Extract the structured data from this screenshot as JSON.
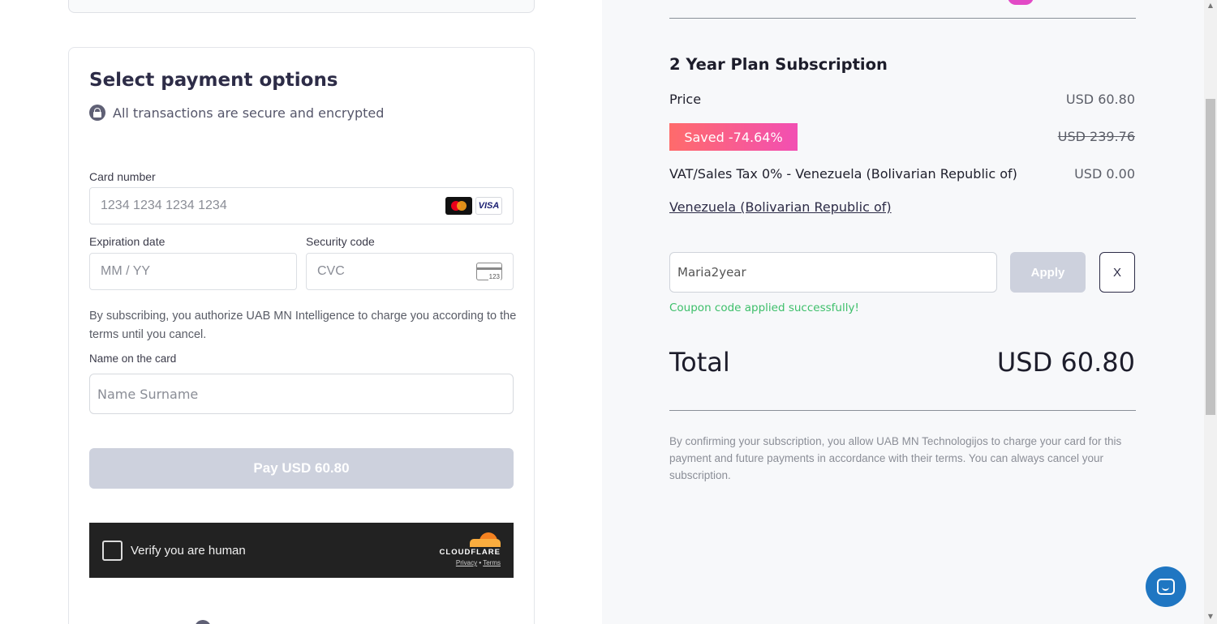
{
  "payment": {
    "title": "Select payment options",
    "secure_text": "All transactions are secure and encrypted",
    "card_number_label": "Card number",
    "card_number_placeholder": "1234 1234 1234 1234",
    "visa_text": "VISA",
    "expiration_label": "Expiration date",
    "expiration_placeholder": "MM / YY",
    "security_label": "Security code",
    "security_placeholder": "CVC",
    "cvc_icon_text": "123",
    "authorize_text": "By subscribing, you authorize UAB MN Intelligence to charge you according to the terms until you cancel.",
    "name_label": "Name on the card",
    "name_placeholder": "Name Surname",
    "pay_button": "Pay USD 60.80"
  },
  "captcha": {
    "label": "Verify you are human",
    "brand": "CLOUDFLARE",
    "privacy": "Privacy",
    "separator": "•",
    "terms": "Terms"
  },
  "summary": {
    "plan_title": "2 Year Plan Subscription",
    "price_label": "Price",
    "price_value": "USD 60.80",
    "saved_badge": "Saved -74.64%",
    "old_price": "USD 239.76",
    "tax_label": "VAT/Sales Tax 0% - Venezuela (Bolivarian Republic of)",
    "tax_value": "USD 0.00",
    "country_link": "Venezuela (Bolivarian Republic of)",
    "coupon_value": "Maria2year",
    "apply_button": "Apply",
    "clear_button": "X",
    "coupon_success": "Coupon code applied successfully!",
    "total_label": "Total",
    "total_value": "USD 60.80",
    "confirm_text": "By confirming your subscription, you allow UAB MN Technologijos to charge your card for this payment and future payments in accordance with their terms. You can always cancel your subscription."
  },
  "colors": {
    "saved_gradient_start": "#ff6b6b",
    "saved_gradient_end": "#f24fb3",
    "success_green": "#3dbf6a",
    "disabled_button": "#cdd1dd",
    "chat_blue": "#1f76c2"
  },
  "icons": {
    "secure": "lock-icon",
    "card_brand_1": "mastercard-icon",
    "card_brand_2": "visa-icon",
    "cvc": "card-cvc-icon",
    "chat": "chat-icon"
  }
}
